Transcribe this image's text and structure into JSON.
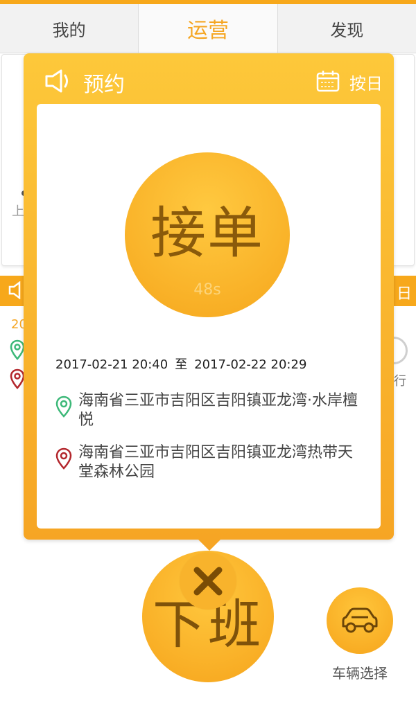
{
  "tabs": [
    {
      "label": "我的"
    },
    {
      "label": "运营"
    },
    {
      "label": "发现"
    }
  ],
  "under_card": {
    "hint": "上"
  },
  "under_strip": {
    "right_char": "日",
    "year_partial": "20",
    "ride_partial": "行"
  },
  "popup": {
    "title": "预约",
    "mode": "按日",
    "accept_label": "接单",
    "countdown": "48s",
    "time_start": "2017-02-21 20:40",
    "time_sep": "至",
    "time_end": "2017-02-22 20:29",
    "start_address": "海南省三亚市吉阳区吉阳镇亚龙湾·水岸檀悦",
    "end_address": "海南省三亚市吉阳区吉阳镇亚龙湾热带天堂森林公园"
  },
  "bottom": {
    "offduty_label": "下班",
    "vehicle_label": "车辆选择"
  },
  "colors": {
    "accent": "#f5a623",
    "popup_top": "#fdc83a",
    "popup_bottom": "#f6a524",
    "start_pin": "#3cb878",
    "end_pin": "#b3262c"
  },
  "icons": [
    "speaker-icon",
    "calendar-icon",
    "location-pin-icon",
    "close-icon",
    "car-icon"
  ]
}
